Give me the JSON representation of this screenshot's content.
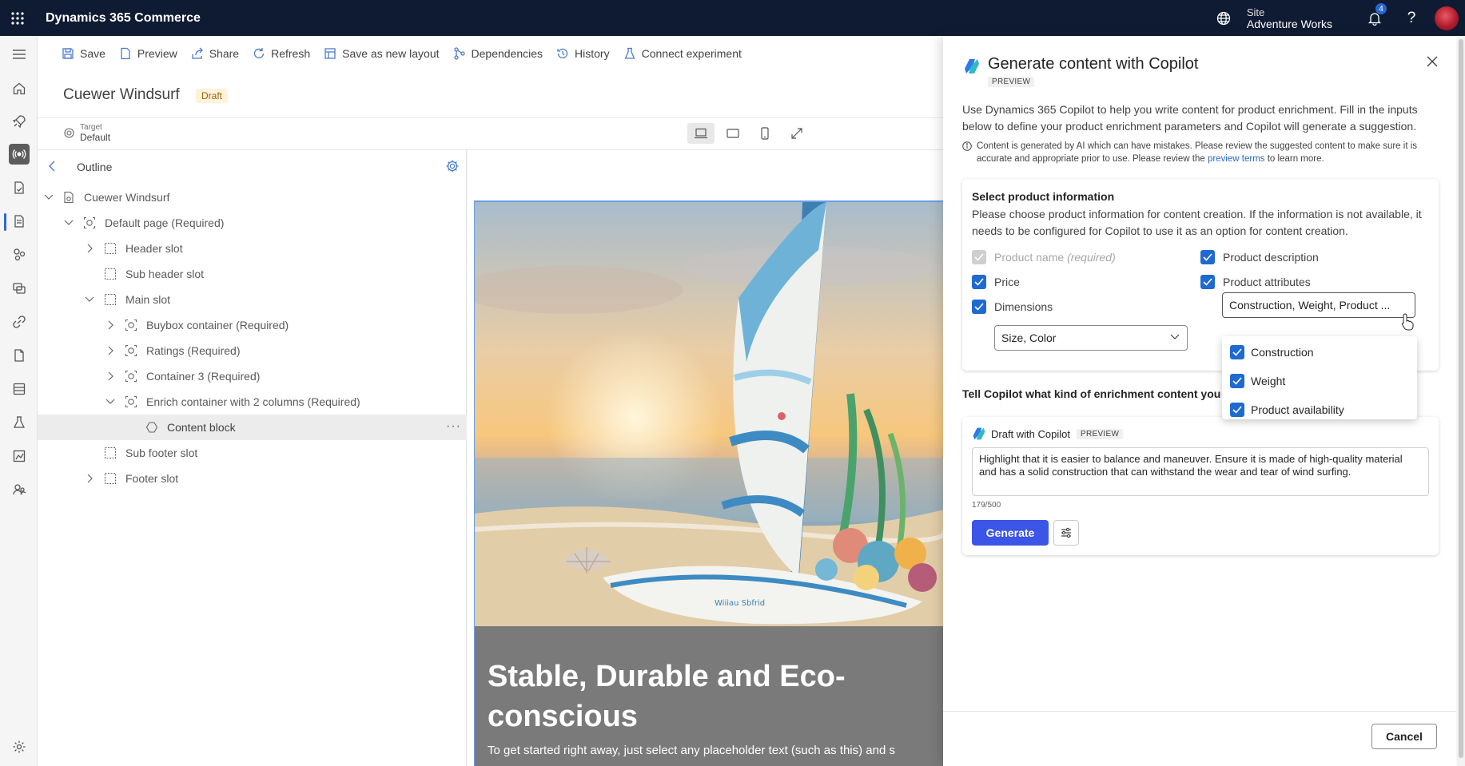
{
  "topbar": {
    "app_title": "Dynamics 365 Commerce",
    "site_label": "Site",
    "site_name": "Adventure Works",
    "notification_count": "4",
    "help_label": "?"
  },
  "commands": {
    "save": "Save",
    "preview": "Preview",
    "share": "Share",
    "refresh": "Refresh",
    "save_layout": "Save as new layout",
    "dependencies": "Dependencies",
    "history": "History",
    "connect_experiment": "Connect experiment"
  },
  "document": {
    "title": "Cuewer Windsurf",
    "status": "Draft",
    "target_label": "Target",
    "target_value": "Default"
  },
  "outline": {
    "title": "Outline",
    "items": [
      {
        "label": "Cuewer Windsurf"
      },
      {
        "label": "Default page (Required)"
      },
      {
        "label": "Header slot"
      },
      {
        "label": "Sub header slot"
      },
      {
        "label": "Main slot"
      },
      {
        "label": "Buybox container (Required)"
      },
      {
        "label": "Ratings (Required)"
      },
      {
        "label": "Container 3 (Required)"
      },
      {
        "label": "Enrich container with 2 columns (Required)"
      },
      {
        "label": "Content block"
      },
      {
        "label": "Sub footer slot"
      },
      {
        "label": "Footer slot"
      }
    ],
    "more_label": "···"
  },
  "canvas": {
    "heading": "Stable, Durable and Eco-conscious",
    "body": "To get started right away, just select any placeholder text (such as this) and s",
    "board_text": "Wiiiau Sbfrid"
  },
  "copilot": {
    "title": "Generate content with Copilot",
    "preview_badge": "PREVIEW",
    "intro": "Use Dynamics 365 Copilot to help you write content for product enrichment. Fill in the inputs below to define your product enrichment parameters and Copilot will generate a suggestion.",
    "note_before": "Content is generated by AI which can have mistakes. Please review the suggested content to make sure it is accurate and appropriate prior to use. Please review the ",
    "note_link": "preview terms",
    "note_after": " to learn more.",
    "select_title": "Select product information",
    "select_desc": "Please choose product information for content creation. If the information is not available, it needs to be configured for Copilot to use it as an option for content creation.",
    "checkboxes": {
      "product_name": "Product name",
      "product_name_suffix": "(required)",
      "product_description": "Product description",
      "price": "Price",
      "product_attributes": "Product attributes",
      "dimensions": "Dimensions"
    },
    "dimensions_select": "Size, Color",
    "attributes_select": "Construction, Weight, Product ...",
    "attribute_options": [
      "Construction",
      "Weight",
      "Product availability"
    ],
    "tell_label": "Tell Copilot what kind of enrichment content you wa",
    "draft_title": "Draft with Copilot",
    "draft_badge": "PREVIEW",
    "prompt_text": "Highlight that it is easier to balance and maneuver.  Ensure it is made of high-quality material and has a solid construction that can withstand the wear and tear of wind surfing.",
    "char_count": "179/500",
    "generate_label": "Generate",
    "cancel_label": "Cancel"
  },
  "colors": {
    "topbar_bg": "#0f1b33",
    "accent": "#1f6ad1",
    "generate_button": "#3b55e6",
    "draft_badge_bg": "#fdf2dc"
  }
}
